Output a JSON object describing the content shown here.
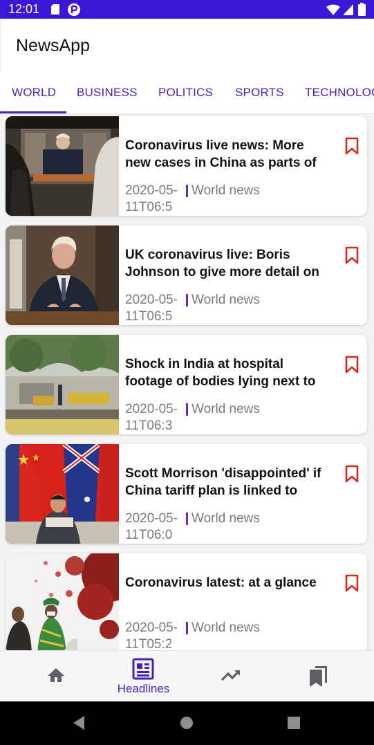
{
  "status_bar": {
    "time": "12:01",
    "icons": [
      "sd-card-icon",
      "app-notification-icon",
      "wifi-icon",
      "signal-icon",
      "battery-icon"
    ]
  },
  "app_bar": {
    "title": "NewsApp"
  },
  "tabs": [
    {
      "label": "WORLD",
      "selected": true
    },
    {
      "label": "BUSINESS",
      "selected": false
    },
    {
      "label": "POLITICS",
      "selected": false
    },
    {
      "label": "SPORTS",
      "selected": false
    },
    {
      "label": "TECHNOLOG",
      "selected": false
    }
  ],
  "articles": [
    {
      "headline": "Coronavirus live news: More new cases in China as parts of",
      "date": "2020-05-11T06:5",
      "category": "World news",
      "thumbnail": "press-conference-tv-screen"
    },
    {
      "headline": "UK coronavirus live: Boris Johnson to give more detail on",
      "date": "2020-05-11T06:5",
      "category": "World news",
      "thumbnail": "prime-minister-address"
    },
    {
      "headline": "Shock in India at hospital footage of bodies lying next to",
      "date": "2020-05-11T06:3",
      "category": "World news",
      "thumbnail": "hospital-exterior"
    },
    {
      "headline": "Scott Morrison 'disappointed' if China tariff plan is linked to",
      "date": "2020-05-11T06:0",
      "category": "World news",
      "thumbnail": "flags-press-conference"
    },
    {
      "headline": "Coronavirus latest: at a glance",
      "date": "2020-05-11T05:2",
      "category": "World news",
      "thumbnail": "virus-illustration"
    }
  ],
  "bottom_nav": [
    {
      "icon": "home-icon",
      "label": "",
      "selected": false
    },
    {
      "icon": "newspaper-icon",
      "label": "Headlines",
      "selected": true
    },
    {
      "icon": "trending-icon",
      "label": "",
      "selected": false
    },
    {
      "icon": "bookmarks-icon",
      "label": "",
      "selected": false
    }
  ],
  "colors": {
    "status_bar": "#3b16d6",
    "accent": "#4a1fc0",
    "bookmark": "#d22a1f",
    "separator": "#6b2ab8"
  }
}
